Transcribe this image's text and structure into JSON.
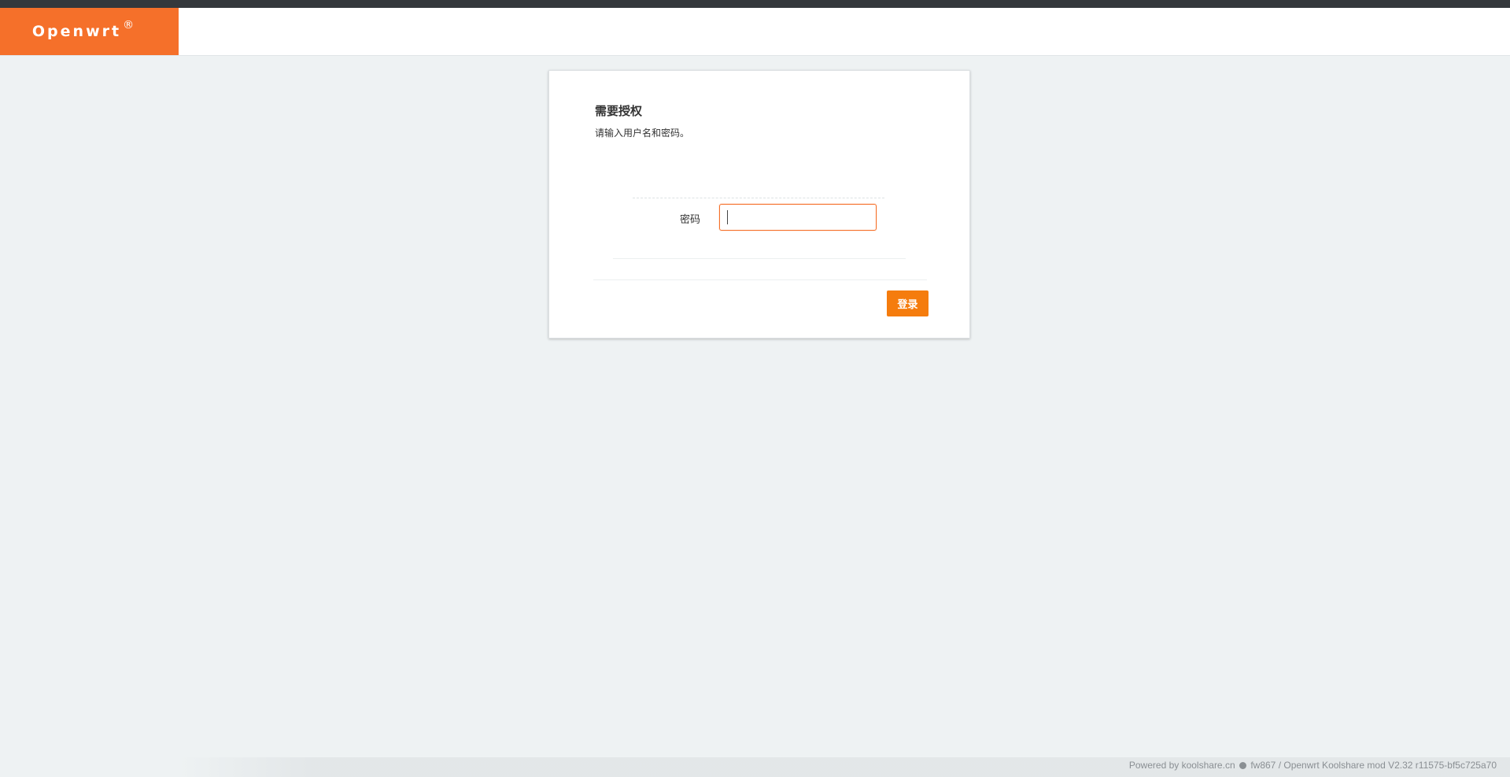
{
  "header": {
    "brand_name": "Openwrt",
    "brand_mark": "®"
  },
  "login": {
    "title": "需要授权",
    "description": "请输入用户名和密码。",
    "password_label": "密码",
    "password_value": "",
    "submit_label": "登录"
  },
  "footer": {
    "powered_by": "Powered by koolshare.cn",
    "firmware_link": "fw867",
    "separator": "/",
    "version": "Openwrt Koolshare mod V2.32 r11575-bf5c725a70"
  },
  "colors": {
    "brand": "#f5702a",
    "button": "#f57c0d",
    "topbar": "#34383c",
    "background": "#eef2f3"
  }
}
